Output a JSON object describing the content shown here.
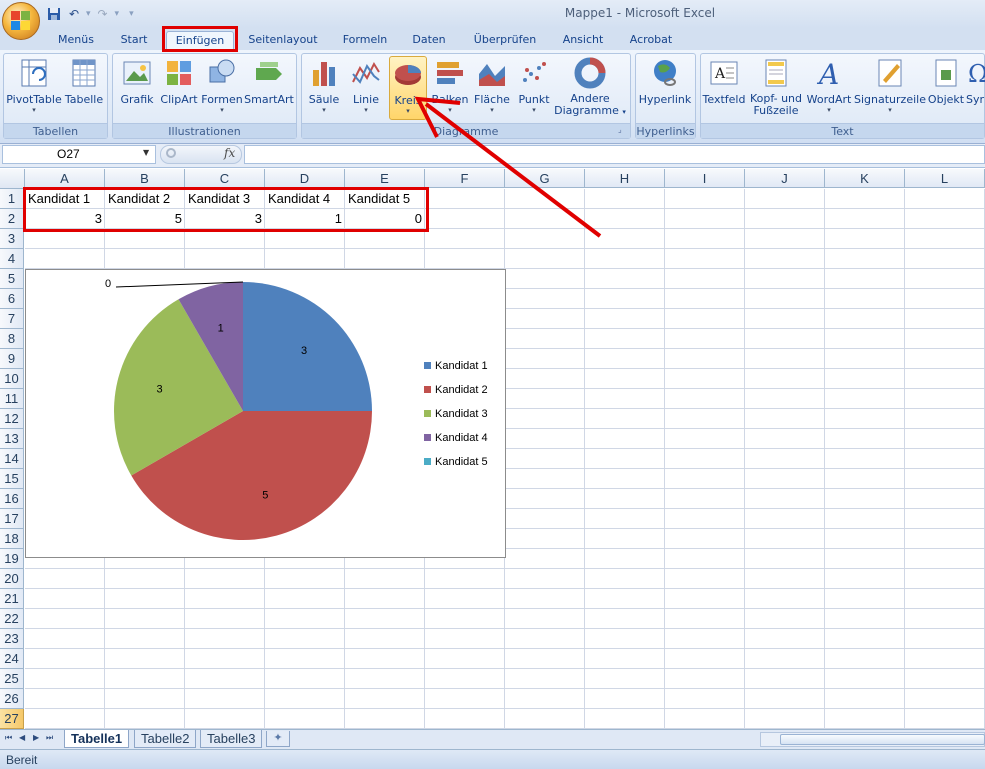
{
  "window": {
    "title": "Mappe1 - Microsoft Excel"
  },
  "tabs": [
    "Menüs",
    "Start",
    "Einfügen",
    "Seitenlayout",
    "Formeln",
    "Daten",
    "Überprüfen",
    "Ansicht",
    "Acrobat"
  ],
  "active_tab": "Einfügen",
  "ribbon": {
    "groups": {
      "tabellen": "Tabellen",
      "illustrationen": "Illustrationen",
      "diagramme": "Diagramme",
      "hyperlinks": "Hyperlinks",
      "text": "Text"
    },
    "buttons": {
      "pivottable": "PivotTable",
      "tabelle": "Tabelle",
      "grafik": "Grafik",
      "clipart": "ClipArt",
      "formen": "Formen",
      "smartart": "SmartArt",
      "saeule": "Säule",
      "linie": "Linie",
      "kreis": "Kreis",
      "balken": "Balken",
      "flaeche": "Fläche",
      "punkt": "Punkt",
      "andere_1": "Andere",
      "andere_2": "Diagramme",
      "hyperlink": "Hyperlink",
      "textfeld": "Textfeld",
      "kopf_1": "Kopf- und",
      "kopf_2": "Fußzeile",
      "wordart": "WordArt",
      "signaturzeile": "Signaturzeile",
      "objekt": "Objekt",
      "symbol": "Syr"
    }
  },
  "formula_bar": {
    "name_box": "O27",
    "fx": "fx",
    "formula": ""
  },
  "columns": [
    "A",
    "B",
    "C",
    "D",
    "E",
    "F",
    "G",
    "H",
    "I",
    "J",
    "K",
    "L"
  ],
  "rows": [
    "1",
    "2",
    "3",
    "4",
    "5",
    "6",
    "7",
    "8",
    "9",
    "10",
    "11",
    "12",
    "13",
    "14",
    "15",
    "16",
    "17",
    "18",
    "19",
    "20",
    "21",
    "22",
    "23",
    "24",
    "25",
    "26",
    "27"
  ],
  "cells": {
    "row1": [
      "Kandidat 1",
      "Kandidat 2",
      "Kandidat 3",
      "Kandidat 4",
      "Kandidat 5"
    ],
    "row2": [
      "3",
      "5",
      "3",
      "1",
      "0"
    ]
  },
  "chart_data": {
    "type": "pie",
    "categories": [
      "Kandidat 1",
      "Kandidat 2",
      "Kandidat 3",
      "Kandidat 4",
      "Kandidat 5"
    ],
    "values": [
      3,
      5,
      3,
      1,
      0
    ],
    "data_labels": [
      "3",
      "5",
      "3",
      "1",
      "0"
    ],
    "colors": [
      "#4f81bd",
      "#c0504d",
      "#9bbb59",
      "#8064a2",
      "#4bacc6"
    ],
    "legend_placement": "right",
    "title": ""
  },
  "sheet_tabs": [
    "Tabelle1",
    "Tabelle2",
    "Tabelle3"
  ],
  "active_sheet": "Tabelle1",
  "status": "Bereit",
  "annotation": {
    "color": "#e00000"
  }
}
